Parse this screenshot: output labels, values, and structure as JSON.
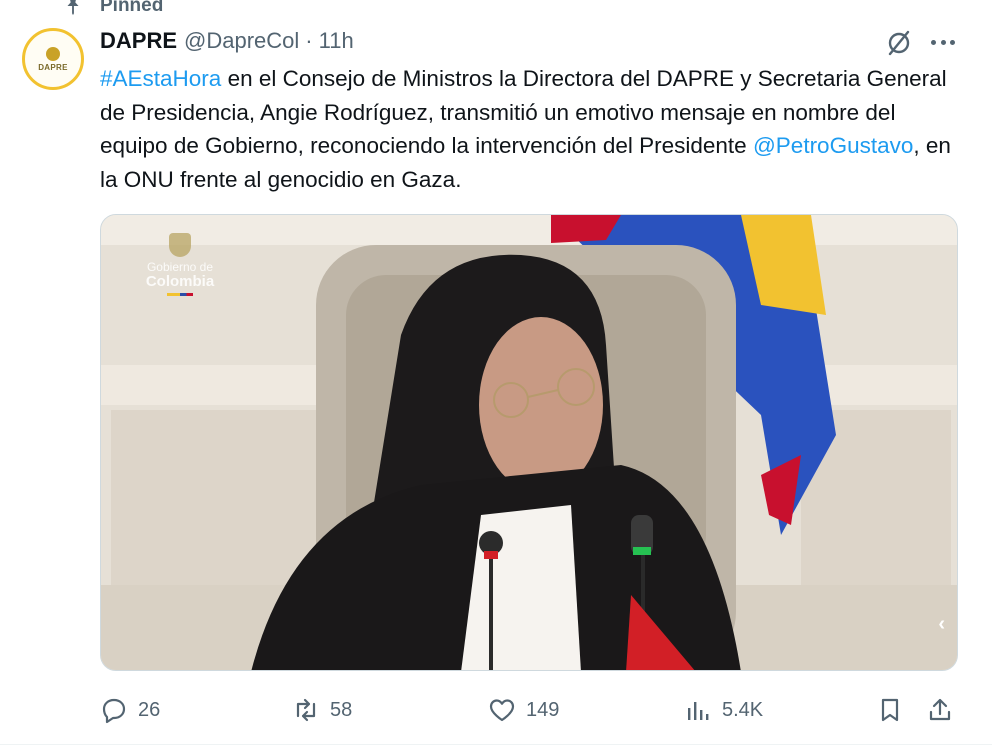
{
  "pinned": {
    "label": "Pinned"
  },
  "author": {
    "display_name": "DAPRE",
    "handle": "@DapreCol",
    "separator": "·",
    "time": "11h",
    "avatar_text": "DAPRE"
  },
  "tweet": {
    "hashtag": "#AEstaHora",
    "text_part1": " en el Consejo de Ministros la Directora del DAPRE y Secretaria General de Presidencia, Angie Rodríguez, transmitió un emotivo mensaje en nombre del equipo de Gobierno, reconociendo la intervención del Presidente ",
    "mention": "@PetroGustavo",
    "text_part2": ", en la ONU frente al genocidio en Gaza."
  },
  "media": {
    "watermark_line1": "Gobierno de",
    "watermark_line2": "Colombia",
    "chevron": "‹"
  },
  "actions": {
    "replies": "26",
    "reposts": "58",
    "likes": "149",
    "views": "5.4K"
  },
  "icons": {
    "pin": "pin-icon",
    "grok": "grok-icon",
    "more": "more-icon",
    "reply": "reply-icon",
    "repost": "repost-icon",
    "like": "heart-icon",
    "views": "views-icon",
    "bookmark": "bookmark-icon",
    "share": "share-icon"
  },
  "colors": {
    "link": "#1d9bf0",
    "secondary_text": "#536471",
    "primary_text": "#0f1419"
  }
}
